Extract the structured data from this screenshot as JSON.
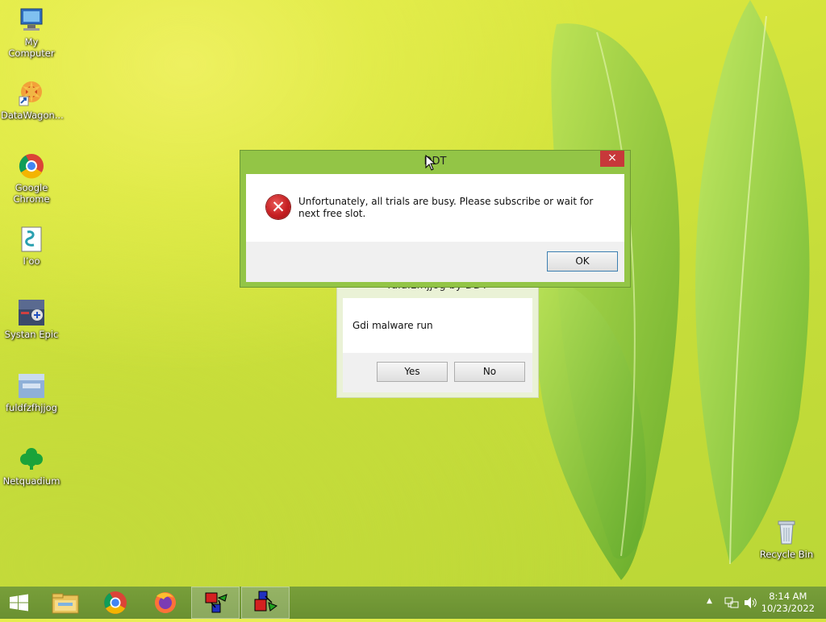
{
  "desktop": {
    "icons": [
      {
        "label": "My Computer",
        "icon": "computer-icon"
      },
      {
        "label": "DataWagon...",
        "icon": "datawagon-icon"
      },
      {
        "label": "Google Chrome",
        "icon": "chrome-icon"
      },
      {
        "label": "I’oo",
        "icon": "script-file-icon"
      },
      {
        "label": "Systan Epic",
        "icon": "systan-epic-icon"
      },
      {
        "label": "fuldfzfhjjog",
        "icon": "fuldfzfhjjog-icon"
      },
      {
        "label": "Netquadium",
        "icon": "netquadium-icon"
      },
      {
        "label": "Recycle Bin",
        "icon": "recycle-bin-icon"
      }
    ]
  },
  "error_dialog": {
    "title": "DDT",
    "message": "Unfortunately, all trials are busy. Please subscribe or wait for next free slot.",
    "close_label": "×",
    "ok_label": "OK"
  },
  "malware_dialog": {
    "title": "fuldfzfhjjog by DDT",
    "message": "Gdi malware run",
    "yes_label": "Yes",
    "no_label": "No"
  },
  "taskbar": {
    "items": [
      "start-button",
      "file-explorer",
      "chrome",
      "firefox",
      "shapes-app",
      "shapes-app-2"
    ],
    "time": "8:14 AM",
    "date": "10/23/2022"
  },
  "colors": {
    "titlebar": "#93c546",
    "taskbar": "#6f9634",
    "close_button": "#c7383a",
    "error_red": "#c61f22"
  }
}
